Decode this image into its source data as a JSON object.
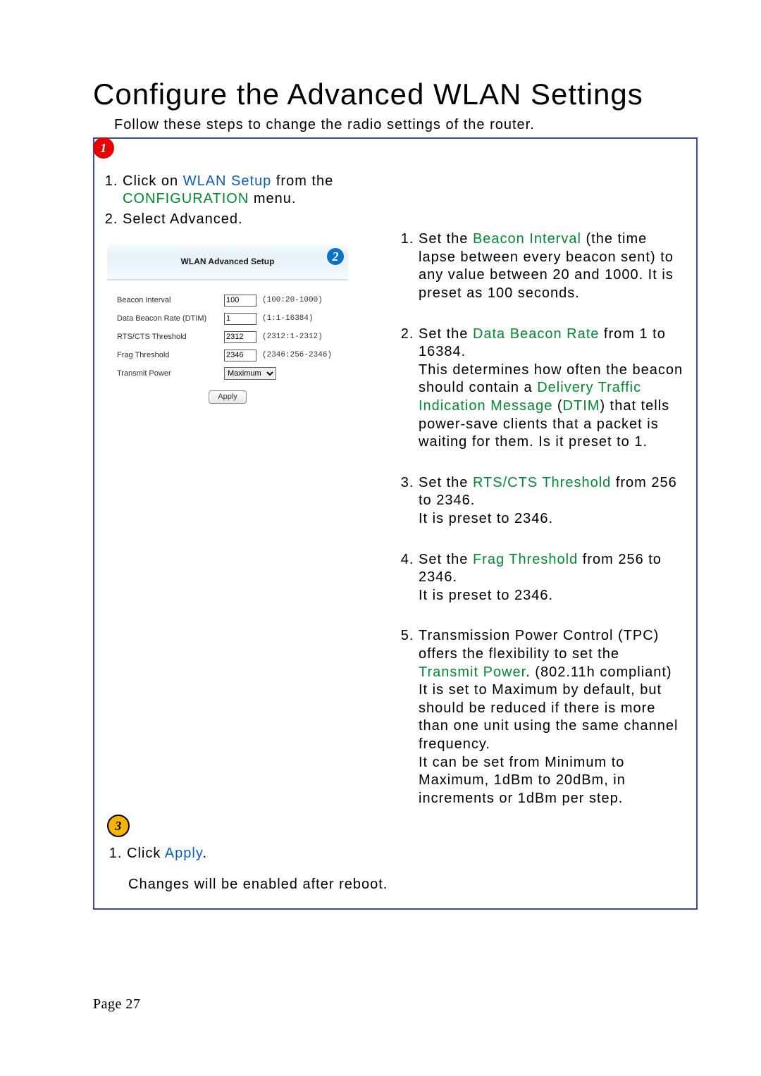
{
  "title": "Configure the Advanced WLAN Settings",
  "intro": "Follow these steps to change the radio settings of the router.",
  "badges": {
    "one": "1",
    "two": "2",
    "three": "3"
  },
  "left_steps": {
    "s1_pre": "Click on ",
    "s1_link": "WLAN Setup",
    "s1_mid": " from the ",
    "s1_green": "CONFIGURATION",
    "s1_post": " menu.",
    "s2": "Select Advanced."
  },
  "panel": {
    "title": "WLAN Advanced Setup",
    "rows": {
      "beacon": {
        "label": "Beacon Interval",
        "value": "100",
        "hint": "(100:20-1000)"
      },
      "dtim": {
        "label": "Data Beacon Rate (DTIM)",
        "value": "1",
        "hint": "(1:1-16384)"
      },
      "rts": {
        "label": "RTS/CTS Threshold",
        "value": "2312",
        "hint": "(2312:1-2312)"
      },
      "frag": {
        "label": "Frag Threshold",
        "value": "2346",
        "hint": "(2346:256-2346)"
      },
      "tx": {
        "label": "Transmit Power",
        "value": "Maximum"
      }
    },
    "apply_label": "Apply"
  },
  "right_steps": {
    "r1_a": "Set the ",
    "r1_g": "Beacon Interval",
    "r1_b": " (the time lapse between every beacon sent) to any value between 20 and 1000.  It is preset as 100 seconds.",
    "r2_a": "Set the ",
    "r2_g": "Data Beacon Rate",
    "r2_b": " from 1 to 16384.",
    "r2_c": "This determines how often the beacon should contain a ",
    "r2_g2": "Delivery Traffic Indication Message",
    "r2_d": " (",
    "r2_g3": "DTIM",
    "r2_e": ") that tells power-save clients that a packet is waiting for them. Is it preset to 1.",
    "r3_a": "Set the ",
    "r3_g": "RTS/CTS Threshold",
    "r3_b": " from 256 to 2346.",
    "r3_c": "It is preset to 2346.",
    "r4_a": "Set the ",
    "r4_g": "Frag Threshold",
    "r4_b": " from 256 to 2346.",
    "r4_c": "It is preset to 2346.",
    "r5_a": "Transmission Power Control (TPC) offers the flexibility to set the ",
    "r5_g": "Transmit Power",
    "r5_b": ". (802.11h compliant)",
    "r5_c": "It is set to Maximum by default, but should be reduced if there is more than one unit using the same channel frequency.",
    "r5_d": "It can be set from Minimum to Maximum, 1dBm to 20dBm, in increments or 1dBm per step."
  },
  "step3": {
    "s1_a": "Click ",
    "s1_l": "Apply",
    "s1_b": ".",
    "note": "Changes will be enabled after reboot."
  },
  "page_footer": "Page 27"
}
